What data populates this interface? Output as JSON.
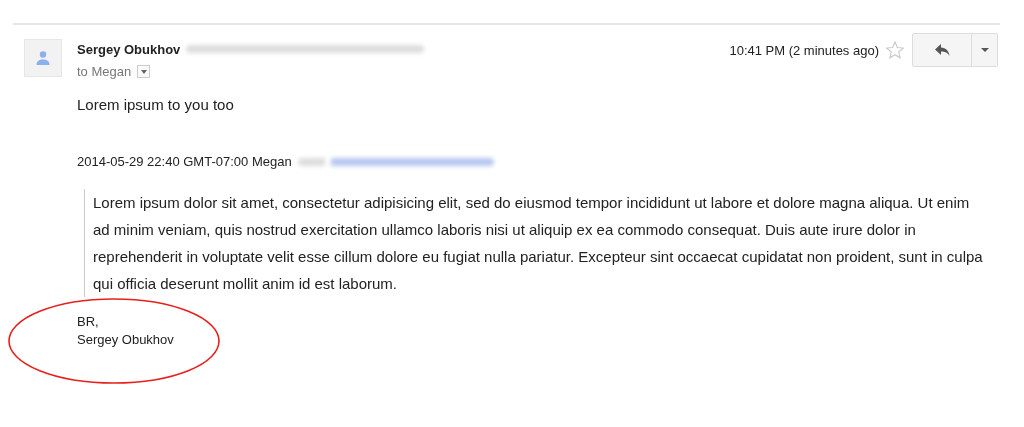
{
  "message": {
    "sender": "Sergey Obukhov",
    "sender_email_blurred": true,
    "recipient": "to Megan",
    "time": "10:41 PM (2 minutes ago)",
    "starred": false,
    "body": "Lorem ipsum to you too",
    "quote_header": {
      "text": "2014-05-29 22:40 GMT-07:00 Megan",
      "address_blurred": true
    },
    "quote": "Lorem ipsum dolor sit amet, consectetur adipisicing elit, sed do eiusmod tempor incididunt ut labore et dolore magna aliqua. Ut enim ad minim veniam, quis nostrud exercitation ullamco laboris nisi ut aliquip ex ea commodo consequat. Duis aute irure dolor in reprehenderit in voluptate velit esse cillum dolore eu fugiat nulla pariatur. Excepteur sint occaecat cupidatat non proident, sunt in culpa qui officia deserunt mollit anim id est laborum.",
    "signature": [
      "BR,",
      "Sergey Obukhov"
    ]
  },
  "annotation": {
    "kind": "ellipse",
    "color": "#e8201c"
  }
}
